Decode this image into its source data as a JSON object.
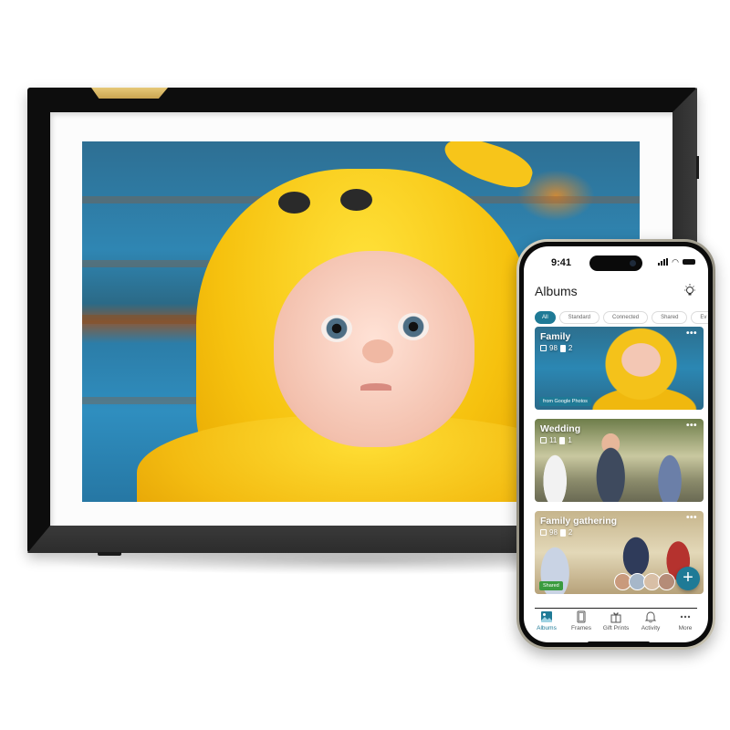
{
  "frame": {
    "description": "Digital photo frame displaying a baby in a yellow hooded costume",
    "accent_gold": "#d8b864"
  },
  "phone": {
    "status_bar": {
      "time": "9:41"
    },
    "header": {
      "title": "Albums",
      "tip_icon": "lightbulb-icon"
    },
    "filters": [
      {
        "label": "All",
        "active": true
      },
      {
        "label": "Standard",
        "active": false
      },
      {
        "label": "Connected",
        "active": false
      },
      {
        "label": "Shared",
        "active": false
      },
      {
        "label": "Ev",
        "active": false
      }
    ],
    "albums": [
      {
        "name": "Family",
        "photos": "98",
        "frames": "2",
        "badge": "from Google Photos",
        "badge_color": "#1f7a96",
        "more": "•••"
      },
      {
        "name": "Wedding",
        "photos": "11",
        "frames": "1",
        "more": "•••"
      },
      {
        "name": "Family gathering",
        "photos": "98",
        "frames": "2",
        "badge": "Shared",
        "badge_color": "#3a9b3f",
        "more": "•••"
      }
    ],
    "fab_label": "+",
    "tabs": [
      {
        "label": "Albums",
        "icon": "image-icon",
        "active": true
      },
      {
        "label": "Frames",
        "icon": "frame-icon",
        "active": false
      },
      {
        "label": "Gift Prints",
        "icon": "gift-icon",
        "active": false
      },
      {
        "label": "Activity",
        "icon": "bell-icon",
        "active": false
      },
      {
        "label": "More",
        "icon": "more-icon",
        "active": false
      }
    ],
    "accent_color": "#1f7a96"
  }
}
